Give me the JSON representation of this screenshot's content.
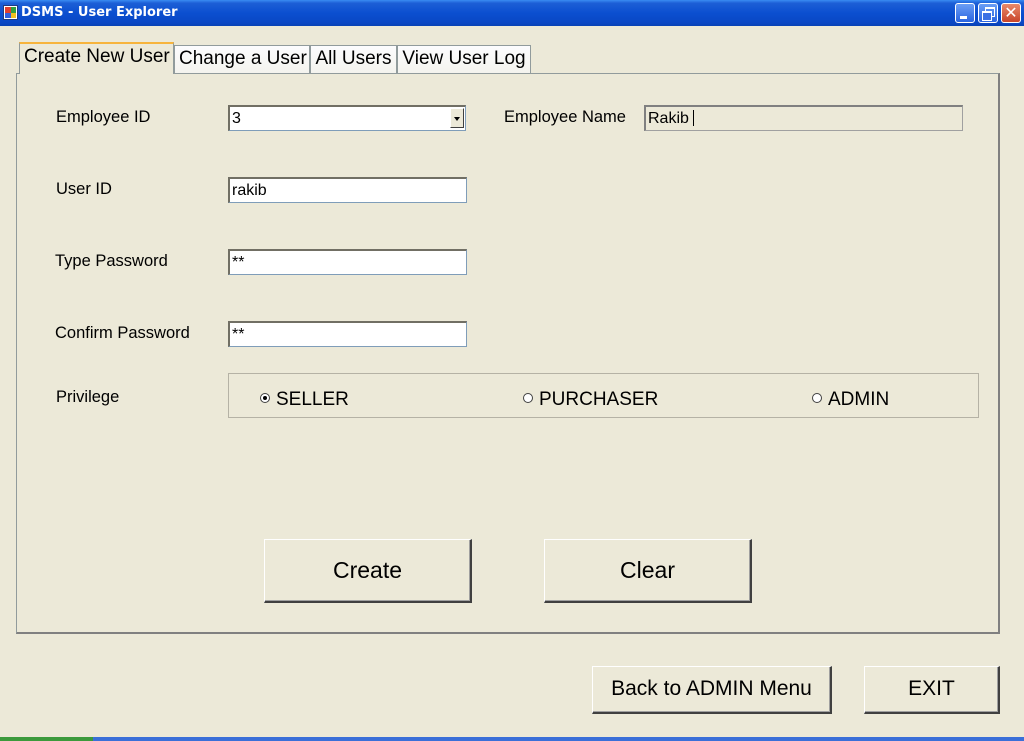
{
  "window": {
    "title": "DSMS - User Explorer"
  },
  "tabs": [
    {
      "label": "Create New User"
    },
    {
      "label": "Change a User"
    },
    {
      "label": "All Users"
    },
    {
      "label": "View User Log"
    }
  ],
  "form": {
    "employee_id_label": "Employee ID",
    "employee_id_value": "3",
    "employee_name_label": "Employee Name",
    "employee_name_value": "Rakib",
    "user_id_label": "User ID",
    "user_id_value": "rakib",
    "password_label": "Type Password",
    "password_value": "**",
    "confirm_label": "Confirm Password",
    "confirm_value": "**",
    "privilege_label": "Privilege",
    "privilege_options": [
      {
        "label": "SELLER",
        "selected": true
      },
      {
        "label": "PURCHASER",
        "selected": false
      },
      {
        "label": "ADMIN",
        "selected": false
      }
    ]
  },
  "buttons": {
    "create": "Create",
    "clear": "Clear",
    "back": "Back to ADMIN Menu",
    "exit": "EXIT"
  },
  "icons": {
    "app": "app-icon",
    "minimize": "minimize-icon",
    "restore": "restore-icon",
    "close": "close-icon",
    "combo": "chevron-down-icon",
    "radio": "radio-icon"
  },
  "colors": {
    "titlebar": "#0a47c4",
    "window_bg": "#ece9d8",
    "tab_highlight": "#f7b43c"
  }
}
